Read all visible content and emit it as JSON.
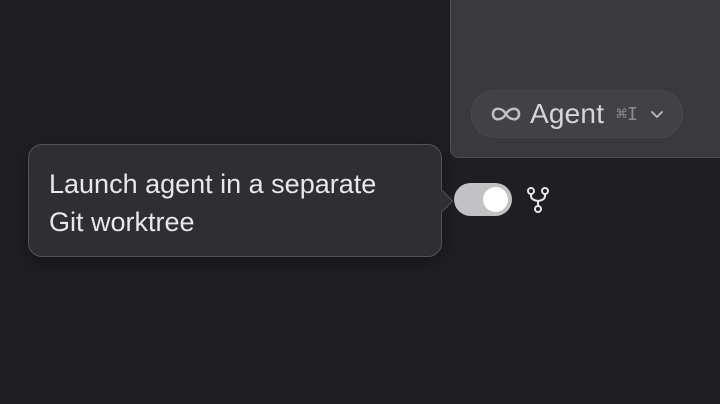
{
  "composer": {
    "mode_selector": {
      "icon": "infinity-icon",
      "label": "Agent",
      "shortcut": "⌘I",
      "chevron_icon": "chevron-down-icon"
    }
  },
  "tooltip": {
    "line1": "Launch agent in a separate",
    "line2": "Git worktree"
  },
  "worktree_toggle": {
    "state": "on"
  },
  "icons": {
    "branch": "git-branch-icon"
  },
  "colors": {
    "background": "#1f1e22",
    "panel": "#3a393c",
    "tooltip_bg": "#2f2e31",
    "toggle_on": "#c2c1c4"
  }
}
